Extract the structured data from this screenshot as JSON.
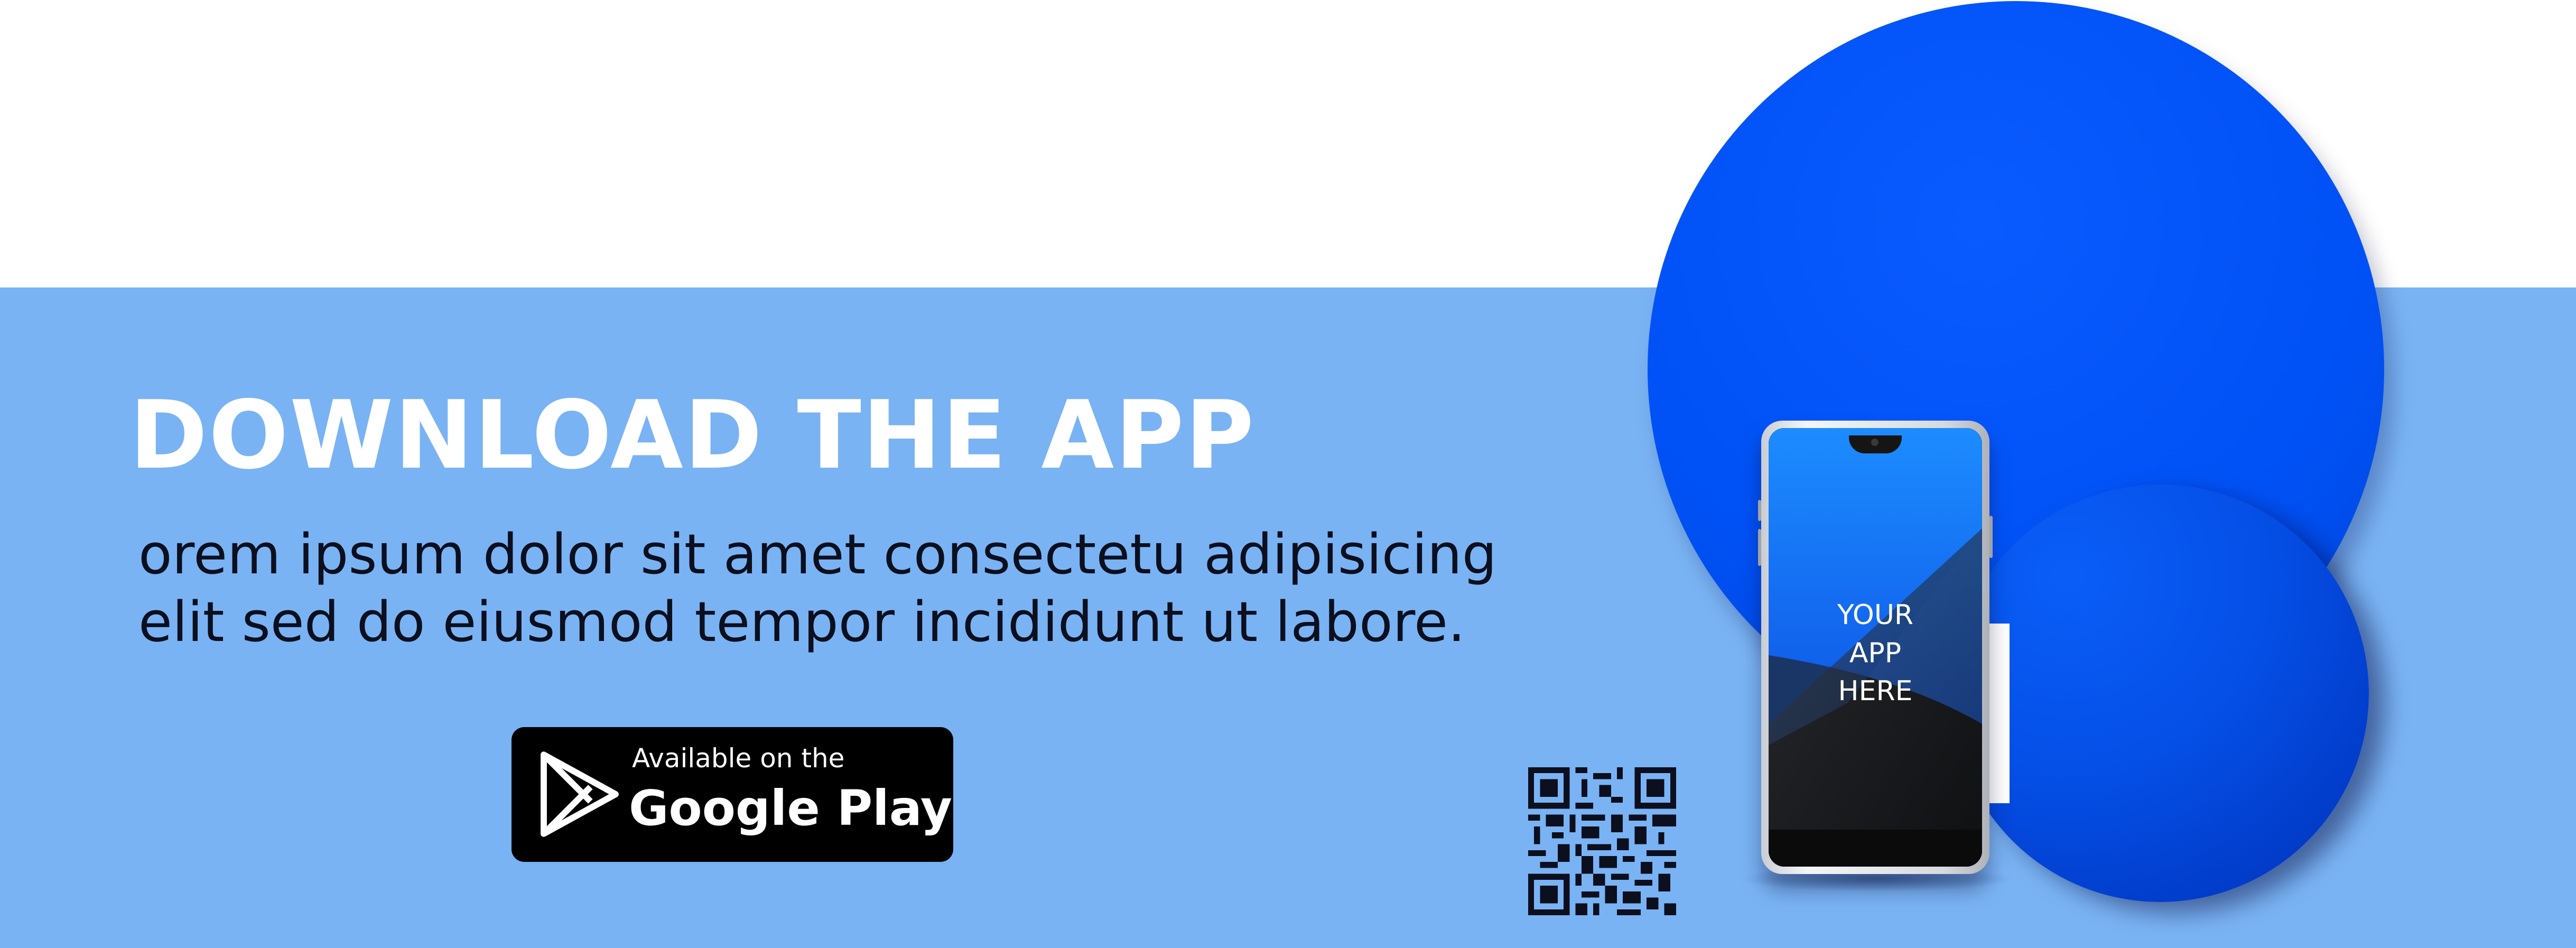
{
  "colors": {
    "band_top": "#ffffff",
    "band_main": "#7ab3f4",
    "accent_blue": "#0051f5",
    "headline_text": "#ffffff",
    "body_text": "#0b0f1e",
    "badge_background": "#000000"
  },
  "banner": {
    "headline": "DOWNLOAD THE APP",
    "description_lines": [
      "orem ipsum dolor sit amet consectetu adipisicing",
      "elit sed do eiusmod tempor incididunt ut labore."
    ]
  },
  "store_badge": {
    "small_text": "Available on the",
    "big_text": "Google Play",
    "icon": "google-play-icon"
  },
  "phone": {
    "screen_lines": [
      "YOUR",
      "APP",
      "HERE"
    ]
  },
  "qr": {
    "icon": "qr-code-icon"
  }
}
